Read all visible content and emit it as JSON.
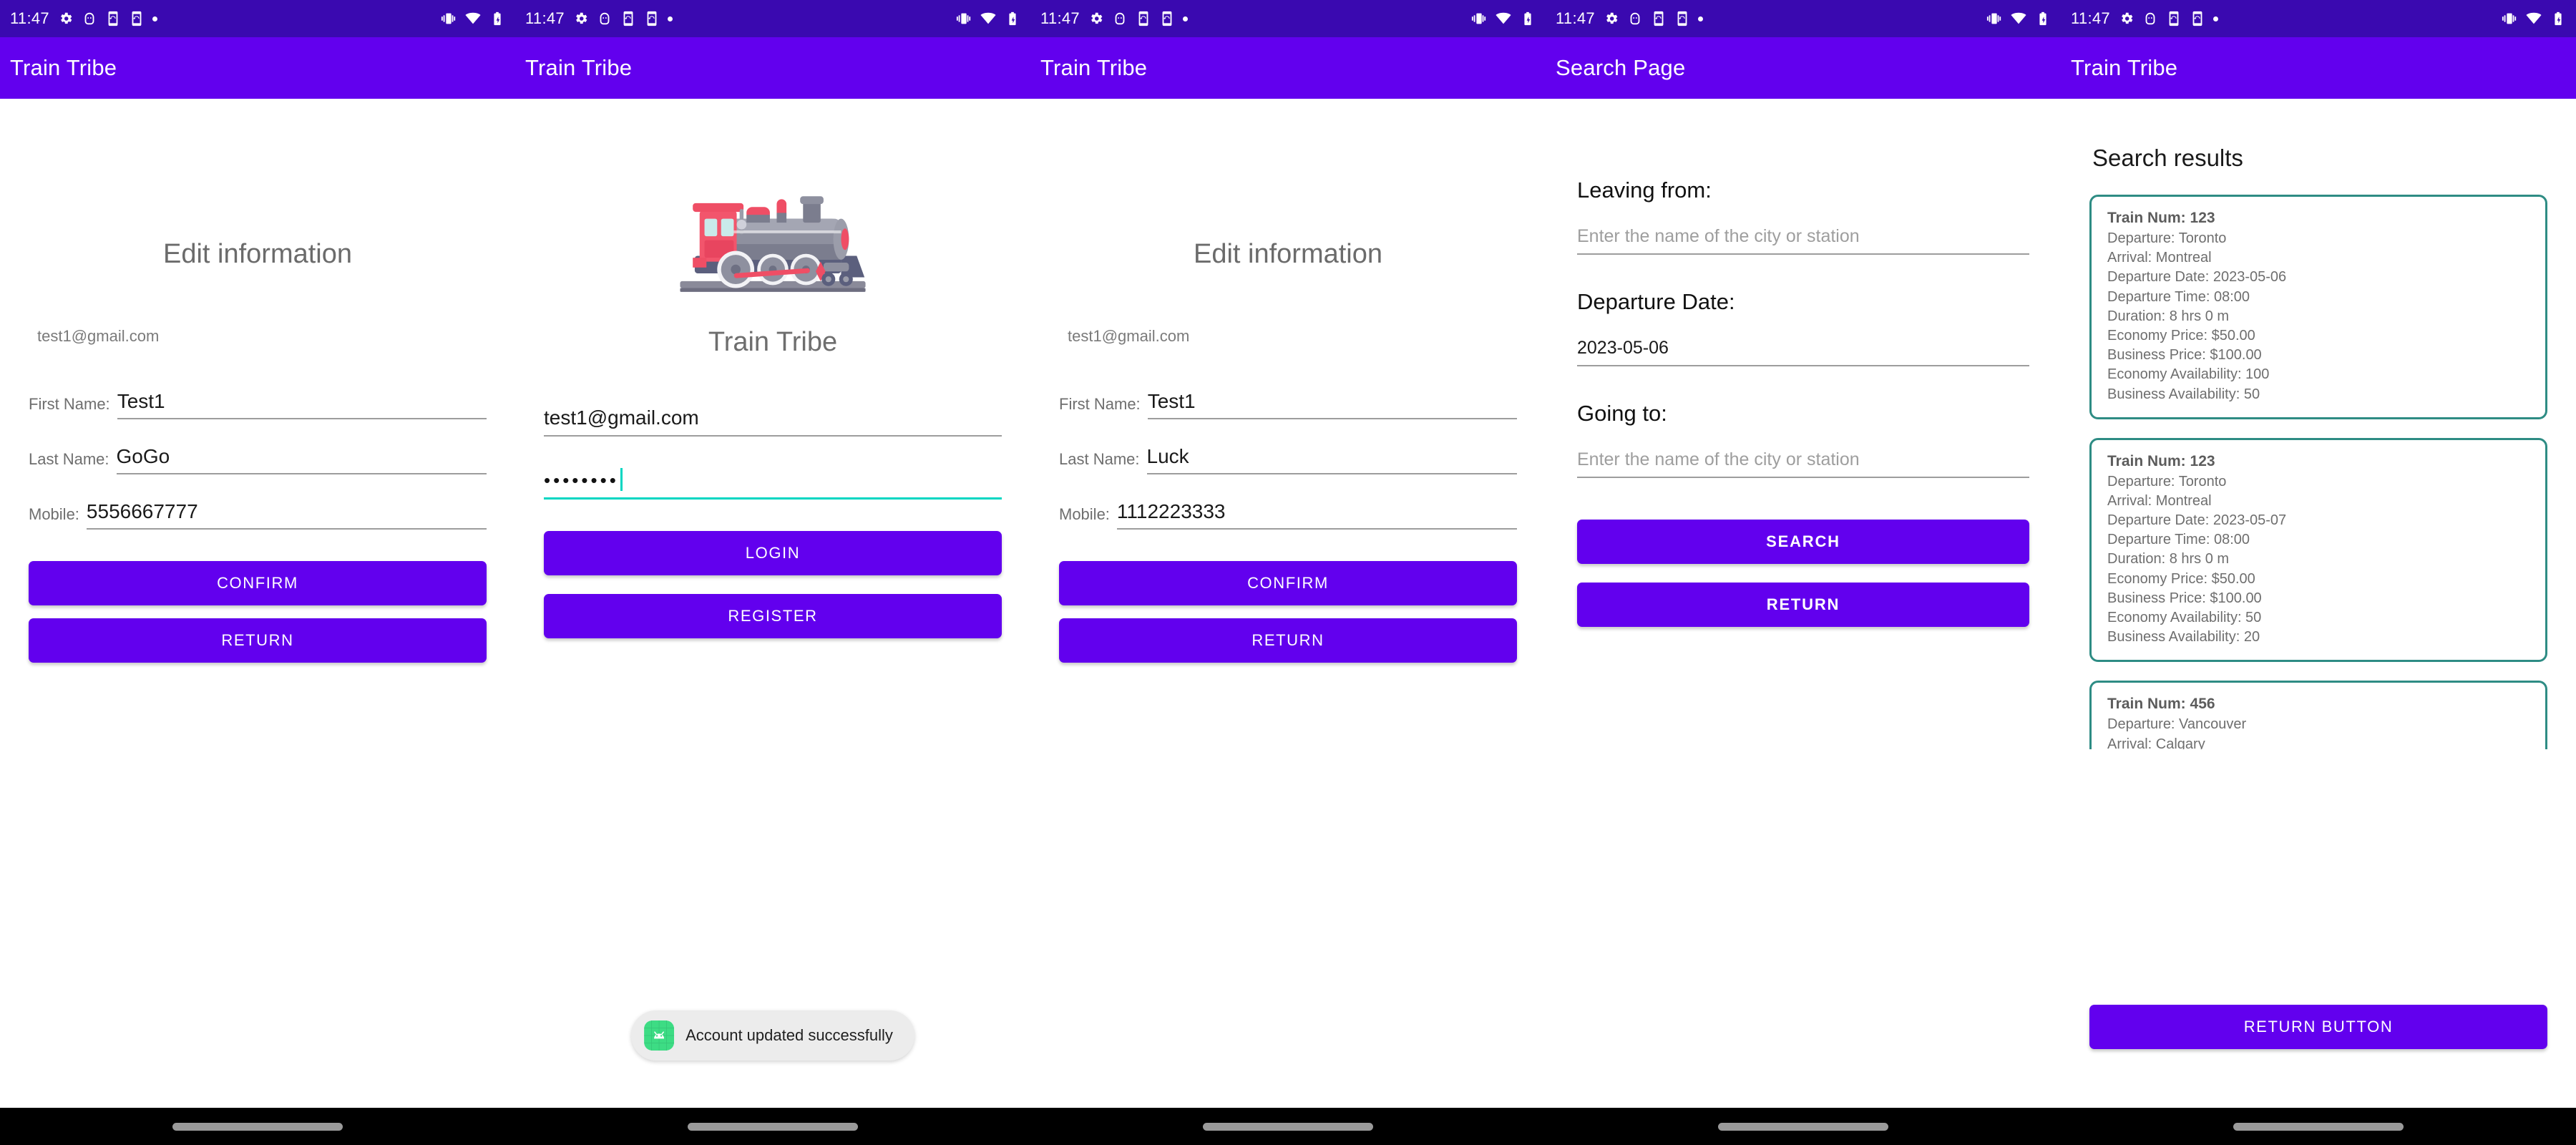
{
  "statusbar": {
    "time": "11:47",
    "left_icons": [
      "gear-icon",
      "face-debug-icon",
      "phone-sync-icon",
      "phone-sync-icon",
      "dot-icon"
    ],
    "right_icons": [
      "vibrate-icon",
      "wifi-icon",
      "battery-charging-icon"
    ]
  },
  "screens": [
    {
      "appbar_title": "Train Tribe",
      "type": "edit",
      "page_title": "Edit information",
      "email": "test1@gmail.com",
      "fields": [
        {
          "label": "First Name:",
          "value": "Test1"
        },
        {
          "label": "Last Name:",
          "value": "GoGo"
        },
        {
          "label": "Mobile:",
          "value": "5556667777"
        }
      ],
      "buttons": [
        "CONFIRM",
        "RETURN"
      ]
    },
    {
      "appbar_title": "Train Tribe",
      "type": "login",
      "brand": "Train Tribe",
      "logo": "steam-locomotive-icon",
      "email_value": "test1@gmail.com",
      "password_masked": "••••••••",
      "buttons": [
        "LOGIN",
        "REGISTER"
      ],
      "toast": {
        "icon": "android-app-icon",
        "message": "Account updated successfully"
      }
    },
    {
      "appbar_title": "Train Tribe",
      "type": "edit",
      "page_title": "Edit information",
      "email": "test1@gmail.com",
      "fields": [
        {
          "label": "First Name:",
          "value": "Test1"
        },
        {
          "label": "Last Name:",
          "value": "Luck"
        },
        {
          "label": "Mobile:",
          "value": "1112223333"
        }
      ],
      "buttons": [
        "CONFIRM",
        "RETURN"
      ]
    },
    {
      "appbar_title": "Search Page",
      "type": "search",
      "leaving_from_label": "Leaving from:",
      "leaving_from_placeholder": "Enter the name of the city or station",
      "departure_date_label": "Departure Date:",
      "departure_date_value": "2023-05-06",
      "going_to_label": "Going to:",
      "going_to_placeholder": "Enter the name of the city or station",
      "buttons": [
        "SEARCH",
        "RETURN"
      ]
    },
    {
      "appbar_title": "Train Tribe",
      "type": "results",
      "results_title": "Search results",
      "return_button": "RETURN BUTTON",
      "cards": [
        {
          "train_num": "Train Num: 123",
          "lines": [
            "Departure: Toronto",
            "Arrival: Montreal",
            "Departure Date: 2023-05-06",
            "Departure Time: 08:00",
            "Duration: 8 hrs 0 m",
            "Economy Price: $50.00",
            "Business Price: $100.00",
            "Economy Availability: 100",
            "Business Availability: 50"
          ]
        },
        {
          "train_num": "Train Num: 123",
          "lines": [
            "Departure: Toronto",
            "Arrival: Montreal",
            "Departure Date: 2023-05-07",
            "Departure Time: 08:00",
            "Duration: 8 hrs 0 m",
            "Economy Price: $50.00",
            "Business Price: $100.00",
            "Economy Availability: 50",
            "Business Availability: 20"
          ]
        },
        {
          "train_num": "Train Num: 456",
          "lines": [
            "Departure: Vancouver",
            "Arrival: Calgary"
          ]
        }
      ]
    }
  ],
  "colors": {
    "statusbar": "#3A09B0",
    "appbar": "#6200EE",
    "primary": "#6200EE",
    "accent_teal": "#00D6C2",
    "card_border": "#2E8C84"
  }
}
